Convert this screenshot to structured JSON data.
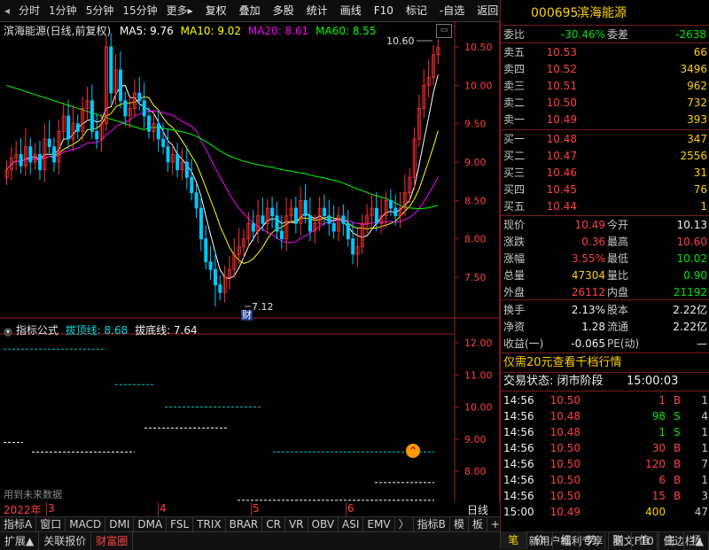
{
  "toolbar": {
    "tabs": [
      "分时",
      "1分钟",
      "5分钟",
      "15分钟",
      "更多"
    ],
    "more_arrow": "▸",
    "buttons": [
      "复权",
      "叠加",
      "多股",
      "统计",
      "画线",
      "F10",
      "标记",
      "-自选",
      "返回"
    ]
  },
  "chart": {
    "title": "滨海能源(日线,前复权)",
    "ma_labels": [
      {
        "text": "MA5: 9.76",
        "color": "#ffffff"
      },
      {
        "text": "MA10: 9.02",
        "color": "#ffff00"
      },
      {
        "text": "MA20: 8.61",
        "color": "#ff00ff"
      },
      {
        "text": "MA60: 8.55",
        "color": "#00ff00"
      }
    ],
    "price_axis": [
      "10.50",
      "10.00",
      "9.50",
      "9.00",
      "8.50",
      "8.00",
      "7.50"
    ],
    "high_label": "10.60",
    "low_label": "7.12",
    "cai_label": "财",
    "indicator_title": "指标公式",
    "ind_top_label": "拔顶线: 8.68",
    "ind_bottom_label": "拔底线: 7.64",
    "ind_axis": [
      "12.00",
      "11.00",
      "10.00",
      "9.00",
      "8.00"
    ],
    "future_note": "用到未来数据",
    "colors": {
      "up": "#ff3232",
      "down": "#00c8ff",
      "ma5": "#ffffff",
      "ma10": "#ffff00",
      "ma20": "#ff00ff",
      "ma60": "#00ff00",
      "axis_border": "#a02020"
    }
  },
  "chart_data": {
    "type": "candlestick",
    "note_series": [
      "MA5",
      "MA10",
      "MA20",
      "MA60"
    ],
    "visible_high": 10.6,
    "visible_low": 7.12,
    "last_close": 10.49
  },
  "datebar": {
    "year": "2022年",
    "marks": [
      "3",
      "4",
      "5",
      "6"
    ]
  },
  "tabbar": [
    "指标A",
    "窗口",
    "MACD",
    "DMI",
    "DMA",
    "FSL",
    "TRIX",
    "BRAR",
    "CR",
    "VR",
    "OBV",
    "ASI",
    "EMV",
    "〉",
    "指标B",
    "模",
    "板",
    "+",
    "-"
  ],
  "daily_label": "日线",
  "statusbar": [
    "扩展▲",
    "关联报价",
    "财富圈",
    "新用户福利专享",
    "图文F10",
    "侧边栏▲"
  ],
  "sidetabs": [
    "笔",
    "价",
    "细",
    "势",
    "联",
    "值",
    "主",
    "扬"
  ],
  "quote": {
    "code": "000695",
    "name": "滨海能源",
    "weibi_label": "委比",
    "weibi": "-30.46%",
    "weicha_label": "委差",
    "weicha": "-2638",
    "sell": [
      {
        "label": "卖五",
        "price": "10.53",
        "vol": "66"
      },
      {
        "label": "卖四",
        "price": "10.52",
        "vol": "3496"
      },
      {
        "label": "卖三",
        "price": "10.51",
        "vol": "962"
      },
      {
        "label": "卖二",
        "price": "10.50",
        "vol": "732"
      },
      {
        "label": "卖一",
        "price": "10.49",
        "vol": "393"
      }
    ],
    "buy": [
      {
        "label": "买一",
        "price": "10.48",
        "vol": "347"
      },
      {
        "label": "买二",
        "price": "10.47",
        "vol": "2556"
      },
      {
        "label": "买三",
        "price": "10.46",
        "vol": "31"
      },
      {
        "label": "买四",
        "price": "10.45",
        "vol": "76"
      },
      {
        "label": "买五",
        "price": "10.44",
        "vol": "1"
      }
    ],
    "stats": [
      {
        "l1": "现价",
        "v1": "10.49",
        "c1": "red",
        "l2": "今开",
        "v2": "10.13",
        "c2": "white"
      },
      {
        "l1": "涨跌",
        "v1": "0.36",
        "c1": "red",
        "l2": "最高",
        "v2": "10.60",
        "c2": "red"
      },
      {
        "l1": "涨幅",
        "v1": "3.55%",
        "c1": "red",
        "l2": "最低",
        "v2": "10.02",
        "c2": "green"
      },
      {
        "l1": "总量",
        "v1": "47304",
        "c1": "yellow",
        "l2": "量比",
        "v2": "0.90",
        "c2": "green"
      },
      {
        "l1": "外盘",
        "v1": "26112",
        "c1": "red",
        "l2": "内盘",
        "v2": "21192",
        "c2": "green"
      }
    ],
    "stats2": [
      {
        "l1": "换手",
        "v1": "2.13%",
        "l2": "股本",
        "v2": "2.22亿"
      },
      {
        "l1": "净资",
        "v1": "1.28",
        "l2": "流通",
        "v2": "2.22亿"
      },
      {
        "l1": "收益(一)",
        "v1": "-0.065",
        "l2": "PE(动)",
        "v2": "—"
      }
    ],
    "promo": "仅需20元查看千档行情",
    "trade_status": "交易状态: 闭市阶段",
    "trade_time": "15:00:03",
    "ticks": [
      {
        "t": "14:56",
        "p": "10.50",
        "v": "1",
        "d": "B",
        "n": "1",
        "c": "red"
      },
      {
        "t": "14:56",
        "p": "10.48",
        "v": "98",
        "d": "S",
        "n": "4",
        "c": "red"
      },
      {
        "t": "14:56",
        "p": "10.48",
        "v": "1",
        "d": "S",
        "n": "1",
        "c": "red"
      },
      {
        "t": "14:56",
        "p": "10.50",
        "v": "30",
        "d": "B",
        "n": "1",
        "c": "red"
      },
      {
        "t": "14:56",
        "p": "10.50",
        "v": "120",
        "d": "B",
        "n": "7",
        "c": "red"
      },
      {
        "t": "14:56",
        "p": "10.50",
        "v": "6",
        "d": "B",
        "n": "1",
        "c": "red"
      },
      {
        "t": "14:56",
        "p": "10.50",
        "v": "15",
        "d": "B",
        "n": "3",
        "c": "red"
      },
      {
        "t": "15:00",
        "p": "10.49",
        "v": "400",
        "d": "",
        "n": "47",
        "c": "red"
      }
    ]
  }
}
